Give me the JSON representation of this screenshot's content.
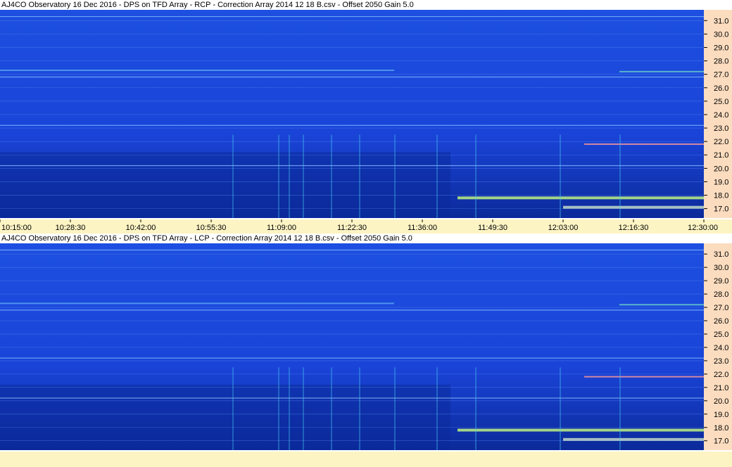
{
  "chart_data": [
    {
      "type": "heatmap",
      "title": "AJ4CO Observatory 16 Dec 2016  -  DPS on TFD Array  -  RCP  -  Correction Array 2014 12 18 B.csv  -  Offset 2050  Gain 5.0",
      "x_tick_labels": [
        "10:15:00",
        "10:28:30",
        "10:42:00",
        "10:55:30",
        "11:09:00",
        "11:22:30",
        "11:36:00",
        "11:49:30",
        "12:03:00",
        "12:16:30",
        "12:30:00"
      ],
      "y_tick_labels": [
        "31.0",
        "30.0",
        "29.0",
        "28.0",
        "27.0",
        "26.0",
        "25.0",
        "24.0",
        "23.0",
        "22.0",
        "21.0",
        "20.0",
        "19.0",
        "18.0",
        "17.0"
      ],
      "y_ticks": [
        31,
        30,
        29,
        28,
        27,
        26,
        25,
        24,
        23,
        22,
        21,
        20,
        19,
        18,
        17
      ],
      "ylim": [
        16.3,
        31.8
      ],
      "grid": true,
      "colors": {
        "background": "#1a44d8",
        "dark": "#0b2a9a",
        "bright": "#46c8f0",
        "burst": "#c8ff80"
      }
    },
    {
      "type": "heatmap",
      "title": "AJ4CO Observatory 16 Dec 2016  -  DPS on TFD Array  -  LCP  -  Correction Array 2014 12 18 B.csv  -  Offset 2050  Gain 5.0",
      "y_tick_labels": [
        "31.0",
        "30.0",
        "29.0",
        "28.0",
        "27.0",
        "26.0",
        "25.0",
        "24.0",
        "23.0",
        "22.0",
        "21.0",
        "20.0",
        "19.0",
        "18.0",
        "17.0"
      ],
      "y_ticks": [
        31,
        30,
        29,
        28,
        27,
        26,
        25,
        24,
        23,
        22,
        21,
        20,
        19,
        18,
        17
      ],
      "ylim": [
        16.3,
        31.8
      ],
      "grid": true,
      "colors": {
        "background": "#1a44d8",
        "dark": "#0b2a9a",
        "bright": "#46c8f0",
        "burst": "#c8ff80"
      }
    }
  ]
}
